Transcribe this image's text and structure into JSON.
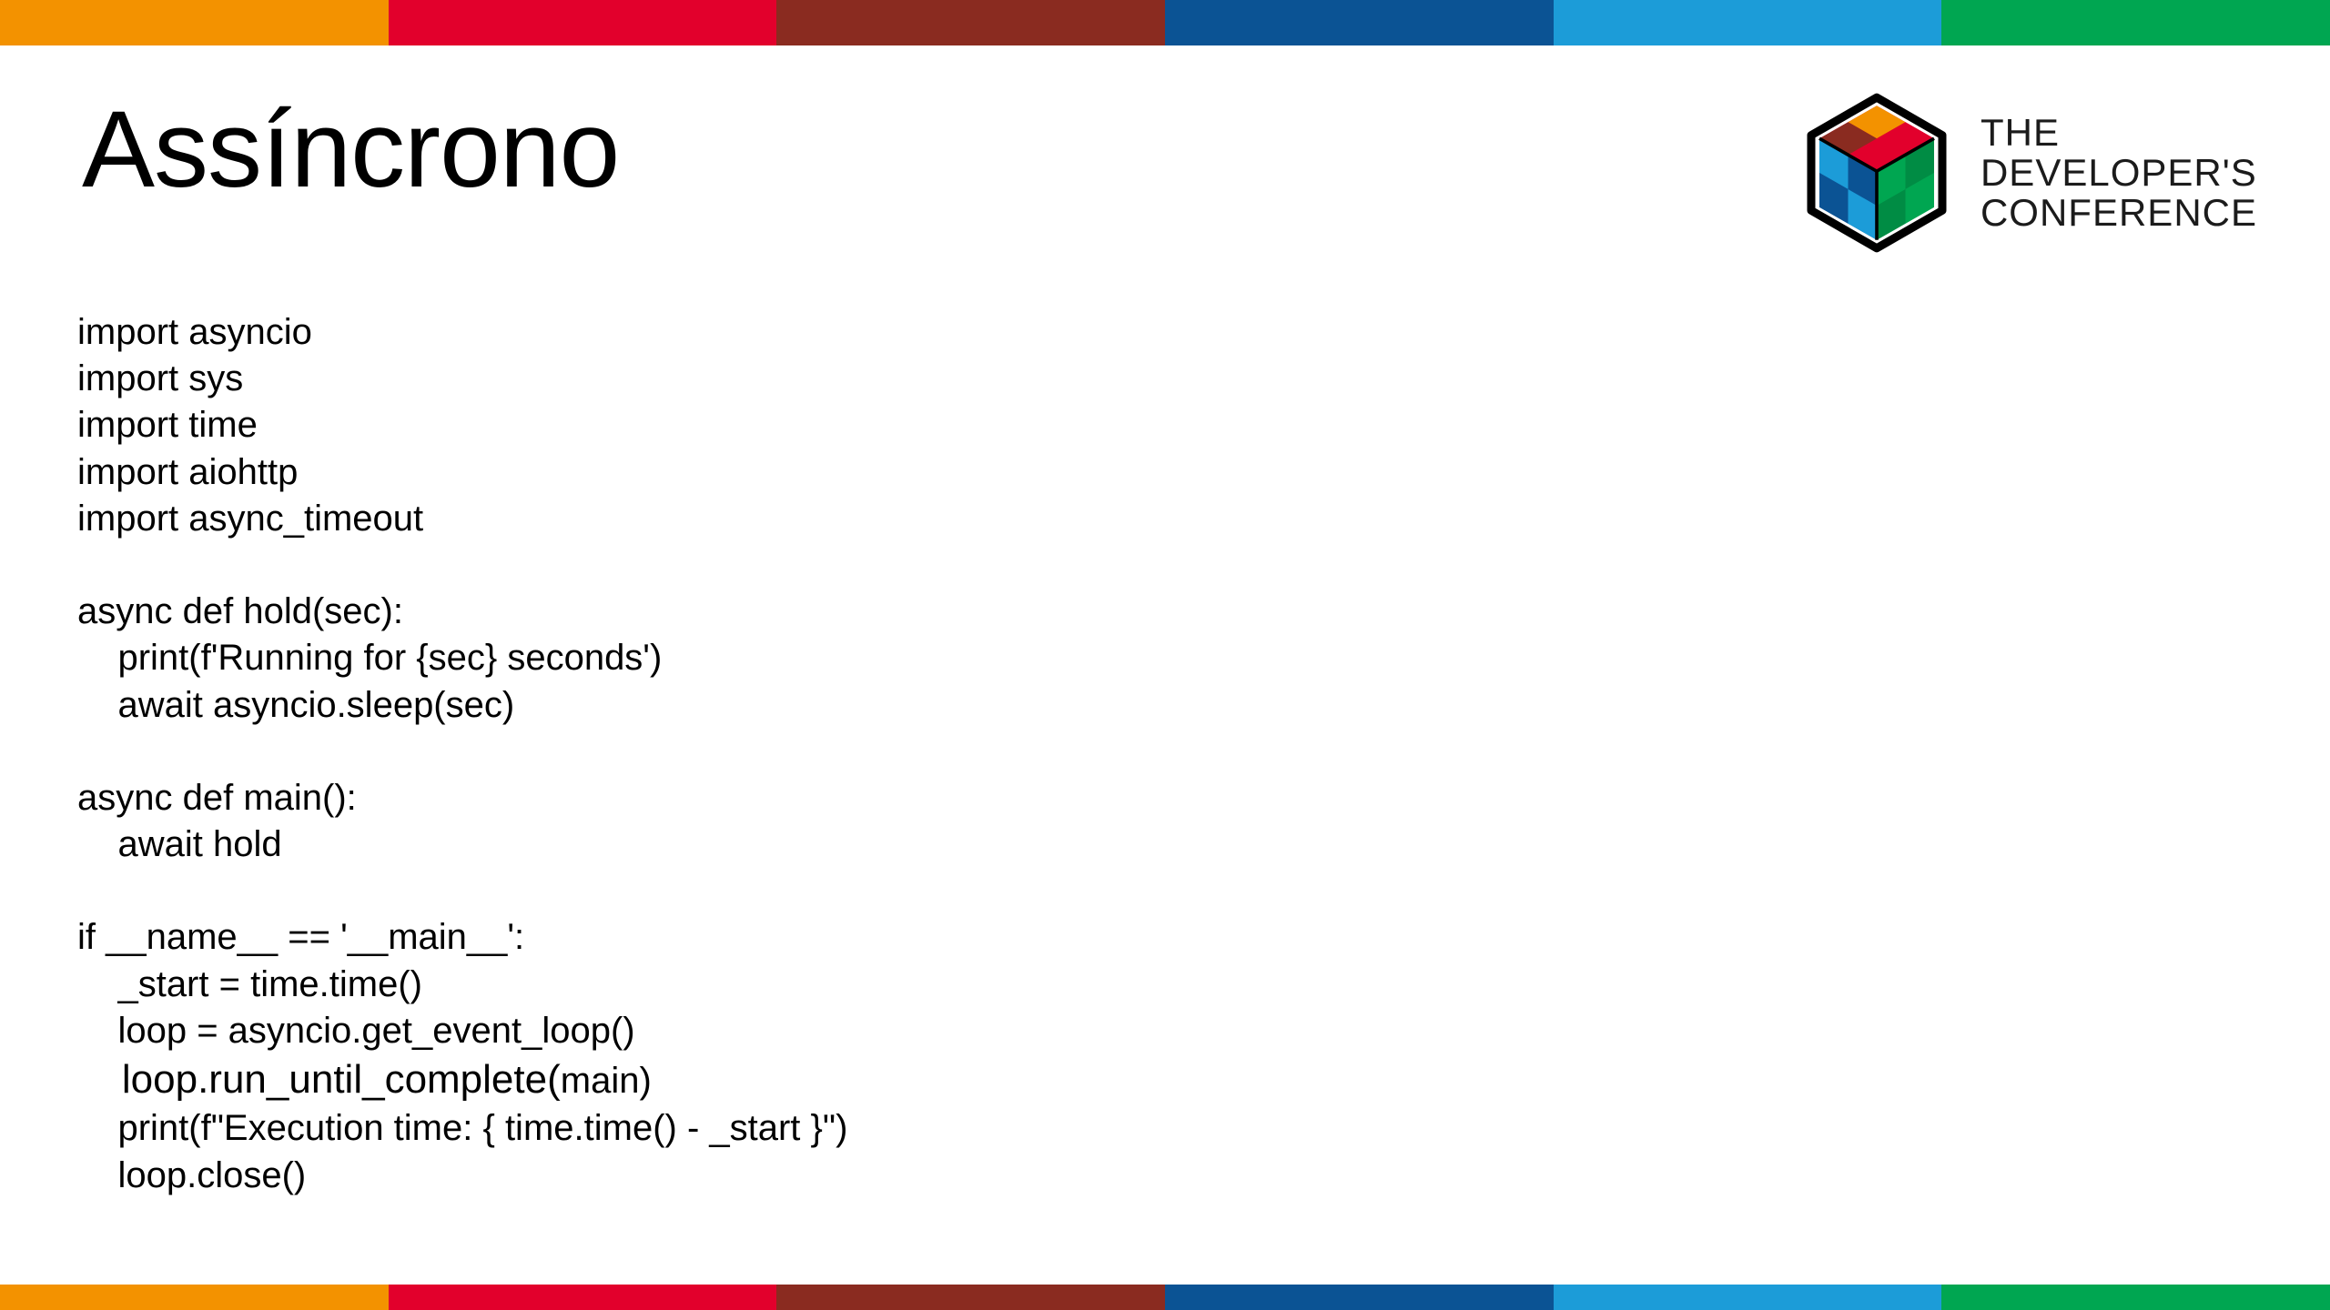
{
  "title": "Assíncrono",
  "logo": {
    "line1": "THE",
    "line2": "DEVELOPER'S",
    "line3": "CONFERENCE"
  },
  "colors": {
    "orange": "#f39200",
    "red": "#e2002c",
    "brown": "#8a2b20",
    "darkblue": "#0b5394",
    "lightblue": "#1c9cd8",
    "green": "#00a651"
  },
  "code": {
    "l01": "import asyncio",
    "l02": "import sys",
    "l03": "import time",
    "l04": "import aiohttp",
    "l05": "import async_timeout",
    "l06": "",
    "l07": "async def hold(sec):",
    "l08": "    print(f'Running for {sec} seconds')",
    "l09": "    await asyncio.sleep(sec)",
    "l10": "",
    "l11": "async def main():",
    "l12": "    await hold",
    "l13": "",
    "l14": "if __name__ == '__main__':",
    "l15": "    _start = time.time()",
    "l16": "    loop = asyncio.get_event_loop()",
    "l17a": "    loop.run_until_complete(",
    "l17b": "main)",
    "l18": "    print(f\"Execution time: { time.time() - _start }\")",
    "l19": "    loop.close()"
  }
}
